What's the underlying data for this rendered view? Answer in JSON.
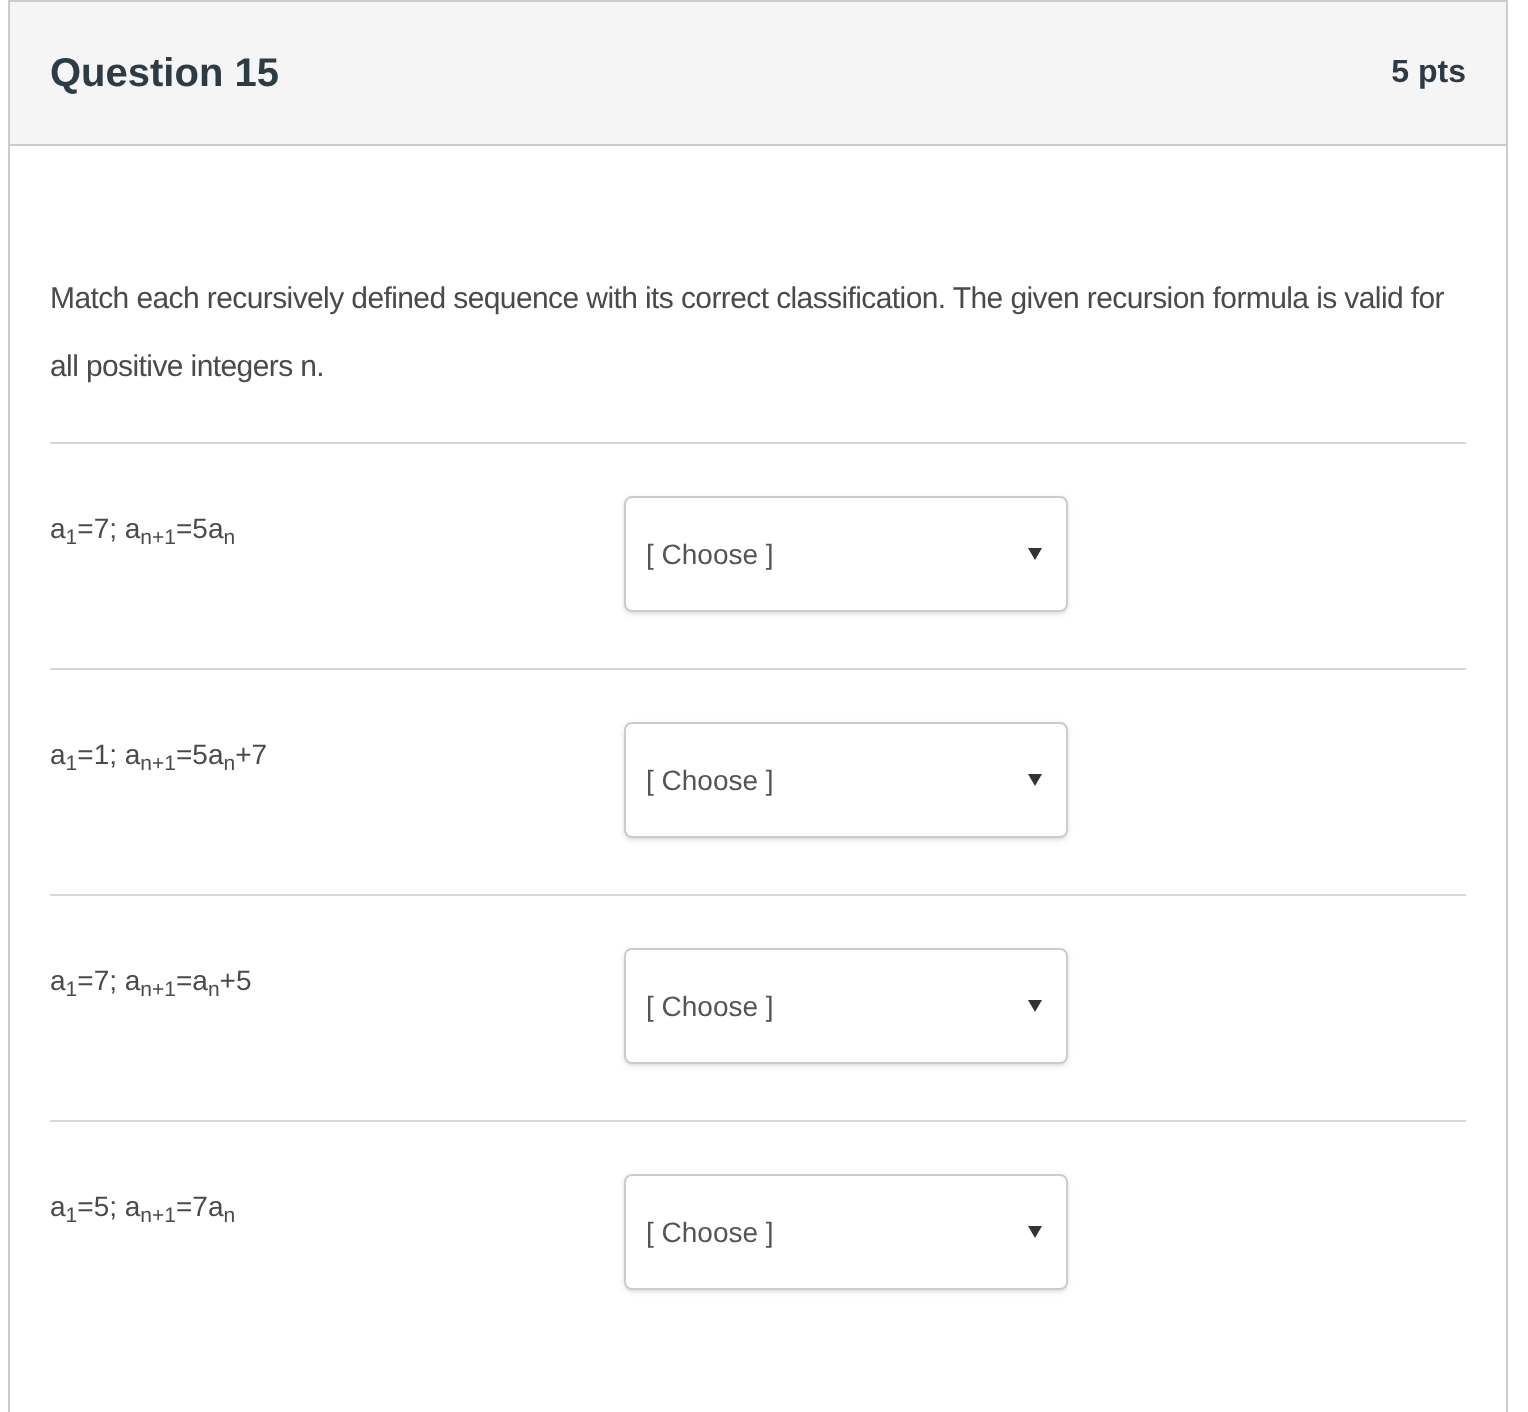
{
  "question": {
    "title": "Question 15",
    "points": "5 pts"
  },
  "prompt": "Match each recursively defined sequence with its correct classification. The given recursion formula is valid for all positive integers n.",
  "matches": [
    {
      "sequence": "a$_{1}$=7; a$_{n+1}$=5a$_{n}$",
      "placeholder": "[ Choose ]"
    },
    {
      "sequence": "a$_{1}$=1; a$_{n+1}$=5a$_{n}$+7",
      "placeholder": "[ Choose ]"
    },
    {
      "sequence": "a$_{1}$=7; a$_{n+1}$=a$_{n}$+5",
      "placeholder": "[ Choose ]"
    },
    {
      "sequence": "a$_{1}$=5; a$_{n+1}$=7a$_{n}$",
      "placeholder": "[ Choose ]"
    }
  ]
}
